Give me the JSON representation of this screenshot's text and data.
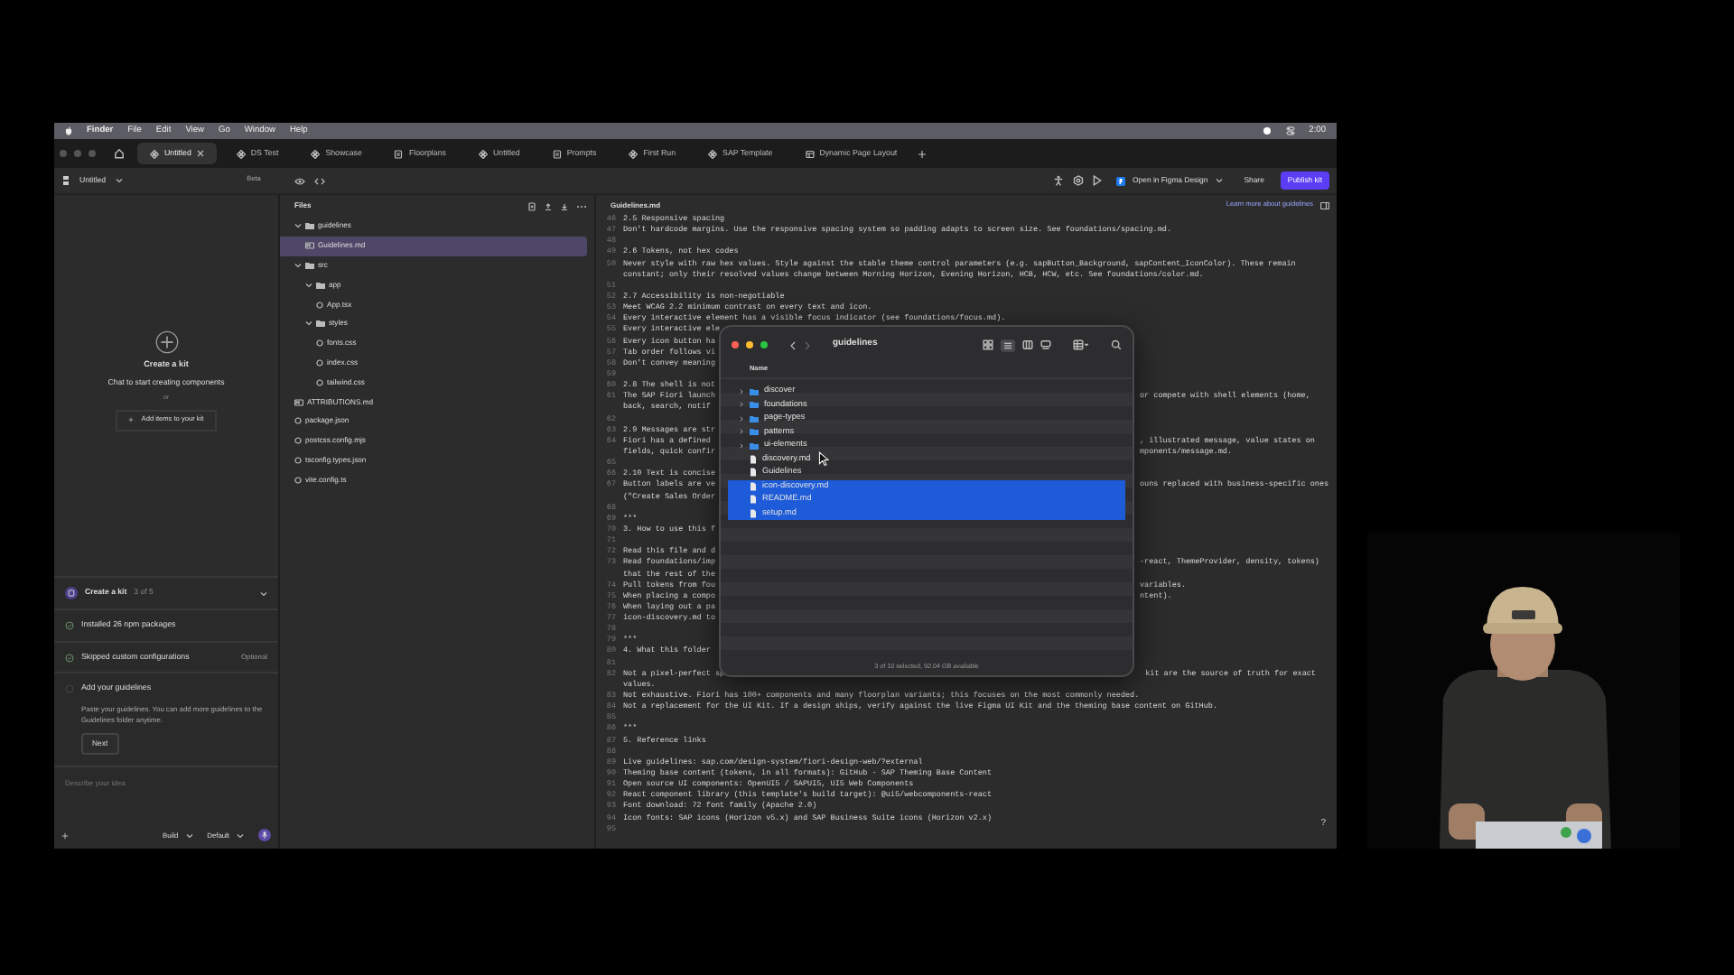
{
  "menu_bar": {
    "app": "Finder",
    "items": [
      "File",
      "Edit",
      "View",
      "Go",
      "Window",
      "Help"
    ],
    "clock": "2:00"
  },
  "tabs": [
    {
      "label": "Untitled",
      "selected": true,
      "kind": "component"
    },
    {
      "label": "DS Test",
      "selected": false,
      "kind": "component"
    },
    {
      "label": "Showcase",
      "selected": false,
      "kind": "component"
    },
    {
      "label": "Floorplans",
      "selected": false,
      "kind": "document"
    },
    {
      "label": "Untitled",
      "selected": false,
      "kind": "component"
    },
    {
      "label": "Prompts",
      "selected": false,
      "kind": "document"
    },
    {
      "label": "First Run",
      "selected": false,
      "kind": "component"
    },
    {
      "label": "SAP Template",
      "selected": false,
      "kind": "component"
    },
    {
      "label": "Dynamic Page Layout",
      "selected": false,
      "kind": "layout"
    }
  ],
  "toolbar": {
    "file_name": "Untitled",
    "badge": "Beta",
    "figma_button": "Open in Figma Design",
    "share": "Share",
    "publish": "Publish kit"
  },
  "chat_panel": {
    "empty_title": "Create a kit",
    "empty_text": "Chat to start creating components",
    "separator": "or",
    "add_button": "Add items to your kit",
    "checklist": {
      "title": "Create a kit",
      "progress": "3 of 5",
      "steps": [
        {
          "label": "Installed 26 npm packages",
          "done": true
        },
        {
          "label": "Skipped custom configurations",
          "done": true,
          "tag": "Optional"
        },
        {
          "label": "Add your guidelines",
          "done": false,
          "text": "Paste your guidelines. You can add more guidelines to the Guidelines folder anytime.",
          "button": "Next"
        }
      ]
    },
    "prompt": {
      "placeholder": "Describe your idea",
      "mode": "Build",
      "model": "Default"
    }
  },
  "files_panel": {
    "title": "Files",
    "tree": [
      {
        "name": "guidelines",
        "kind": "folder",
        "expanded": true,
        "selected": false,
        "children": [
          {
            "name": "Guidelines.md",
            "kind": "markdown",
            "selected": true
          }
        ]
      },
      {
        "name": "src",
        "kind": "folder",
        "expanded": true,
        "selected": false,
        "children": [
          {
            "name": "app",
            "kind": "folder",
            "expanded": true,
            "selected": false,
            "children": [
              {
                "name": "App.tsx",
                "kind": "file",
                "selected": false
              }
            ]
          },
          {
            "name": "styles",
            "kind": "folder",
            "expanded": true,
            "selected": false,
            "children": [
              {
                "name": "fonts.css",
                "kind": "file",
                "selected": false
              },
              {
                "name": "index.css",
                "kind": "file",
                "selected": false
              },
              {
                "name": "tailwind.css",
                "kind": "file",
                "selected": false
              }
            ]
          }
        ]
      },
      {
        "name": "ATTRIBUTIONS.md",
        "kind": "markdown",
        "selected": false
      },
      {
        "name": "package.json",
        "kind": "file",
        "selected": false
      },
      {
        "name": "postcss.config.mjs",
        "kind": "file",
        "selected": false
      },
      {
        "name": "tsconfig.types.json",
        "kind": "file",
        "selected": false
      },
      {
        "name": "vite.config.ts",
        "kind": "file",
        "selected": false
      }
    ]
  },
  "editor": {
    "file_name": "Guidelines.md",
    "link": "Learn more about guidelines",
    "help": "?",
    "lines": [
      {
        "number": "46",
        "text": "2.5 Responsive spacing"
      },
      {
        "number": "47",
        "text": "Don't hardcode margins. Use the responsive spacing system so padding adapts to screen size. See foundations/spacing.md."
      },
      {
        "number": "48"
      },
      {
        "number": "49",
        "text": "2.6 Tokens, not hex codes"
      },
      {
        "number": "50",
        "text": "Never style with raw hex values. Style against the stable theme control parameters (e.g. sapButton_Background, sapContent_IconColor). These remain"
      },
      {
        "text": "constant; only their resolved values change between Morning Horizon, Evening Horizon, HCB, HCW, etc. See foundations/color.md."
      },
      {
        "number": "51"
      },
      {
        "number": "52",
        "text": "2.7 Accessibility is non-negotiable"
      },
      {
        "number": "53",
        "text": "Meet WCAG 2.2 minimum contrast on every text and icon."
      },
      {
        "number": "54",
        "text": "Every interactive element has a visible focus indicator (see foundations/focus.md)."
      },
      {
        "number": "55",
        "text": "Every interactive ele"
      },
      {
        "number": "56",
        "text": "Every icon button ha"
      },
      {
        "number": "57",
        "text": "Tab order follows vi"
      },
      {
        "number": "58",
        "text": "Don't convey meaning"
      },
      {
        "number": "59"
      },
      {
        "number": "60",
        "text": "2.8 The shell is not"
      },
      {
        "number": "61",
        "text": "The SAP Fiori launch",
        "right": "or compete with shell elements (home,"
      },
      {
        "text": "back, search, notif"
      },
      {
        "number": "62"
      },
      {
        "number": "63",
        "text": "2.9 Messages are str"
      },
      {
        "number": "64",
        "text": "Fiori has a defined",
        "right": ", illustrated message, value states on"
      },
      {
        "text": "fields, quick confir",
        "right": "mponents/message.md."
      },
      {
        "number": "65"
      },
      {
        "number": "66",
        "text": "2.10 Text is concise"
      },
      {
        "number": "67",
        "text": "Button labels are ve",
        "right": "ouns replaced with business-specific ones"
      },
      {
        "text": "(\"Create Sales Order"
      },
      {
        "number": "68"
      },
      {
        "number": "69",
        "text": "***"
      },
      {
        "number": "70",
        "text": "3. How to use this f"
      },
      {
        "number": "71"
      },
      {
        "number": "72",
        "text": "Read this file and d"
      },
      {
        "number": "73",
        "text": "Read foundations/imp",
        "right": "-react, ThemeProvider, density, tokens)"
      },
      {
        "text": "that the rest of the"
      },
      {
        "number": "74",
        "text": "Pull tokens from fou",
        "right": "variables."
      },
      {
        "number": "75",
        "text": "When placing a compo",
        "right": "ntent)."
      },
      {
        "number": "76",
        "text": "When laying out a pa"
      },
      {
        "number": "77",
        "text": "icon-discovery.md to"
      },
      {
        "number": "78"
      },
      {
        "number": "79",
        "text": "***"
      },
      {
        "number": "80",
        "text": "4. What this folder"
      },
      {
        "number": "81"
      },
      {
        "number": "82",
        "text": "Not a pixel-perfect sp",
        "right": "kit are the source of truth for exact"
      },
      {
        "text": "values."
      },
      {
        "number": "83",
        "text": "Not exhaustive. Fiori has 100+ components and many floorplan variants; this focuses on the most commonly needed."
      },
      {
        "number": "84",
        "text": "Not a replacement for the UI Kit. If a design ships, verify against the live Figma UI Kit and the theming base content on GitHub."
      },
      {
        "number": "85"
      },
      {
        "number": "86",
        "text": "***"
      },
      {
        "number": "87",
        "text": "5. Reference links"
      },
      {
        "number": "88"
      },
      {
        "number": "89",
        "text": "Live guidelines: sap.com/design-system/fiori-design-web/?external"
      },
      {
        "number": "90",
        "text": "Theming base content (tokens, in all formats): GitHub - SAP Theming Base Content"
      },
      {
        "number": "91",
        "text": "Open source UI components: OpenUI5 / SAPUI5, UI5 Web Components"
      },
      {
        "number": "92",
        "text": "React component library (this template's build target): @ui5/webcomponents-react"
      },
      {
        "number": "93",
        "text": "Font download: 72 font family (Apache 2.0)"
      },
      {
        "number": "94",
        "text": "Icon fonts: SAP icons (Horizon v5.x) and SAP Business Suite icons (Horizon v2.x)"
      },
      {
        "number": "95"
      }
    ]
  },
  "finder": {
    "title": "guidelines",
    "column": "Name",
    "items": [
      {
        "name": "discover",
        "kind": "folder",
        "selected": false
      },
      {
        "name": "foundations",
        "kind": "folder",
        "selected": false
      },
      {
        "name": "page-types",
        "kind": "folder",
        "selected": false
      },
      {
        "name": "patterns",
        "kind": "folder",
        "selected": false
      },
      {
        "name": "ui-elements",
        "kind": "folder",
        "selected": false
      },
      {
        "name": "discovery.md",
        "kind": "document",
        "selected": false
      },
      {
        "name": "Guidelines",
        "kind": "document",
        "selected": false
      },
      {
        "name": "icon-discovery.md",
        "kind": "document",
        "selected": true
      },
      {
        "name": "README.md",
        "kind": "document",
        "selected": true
      },
      {
        "name": "setup.md",
        "kind": "document",
        "selected": true
      }
    ],
    "status": "3 of 10 selected, 92.04 GB available"
  }
}
